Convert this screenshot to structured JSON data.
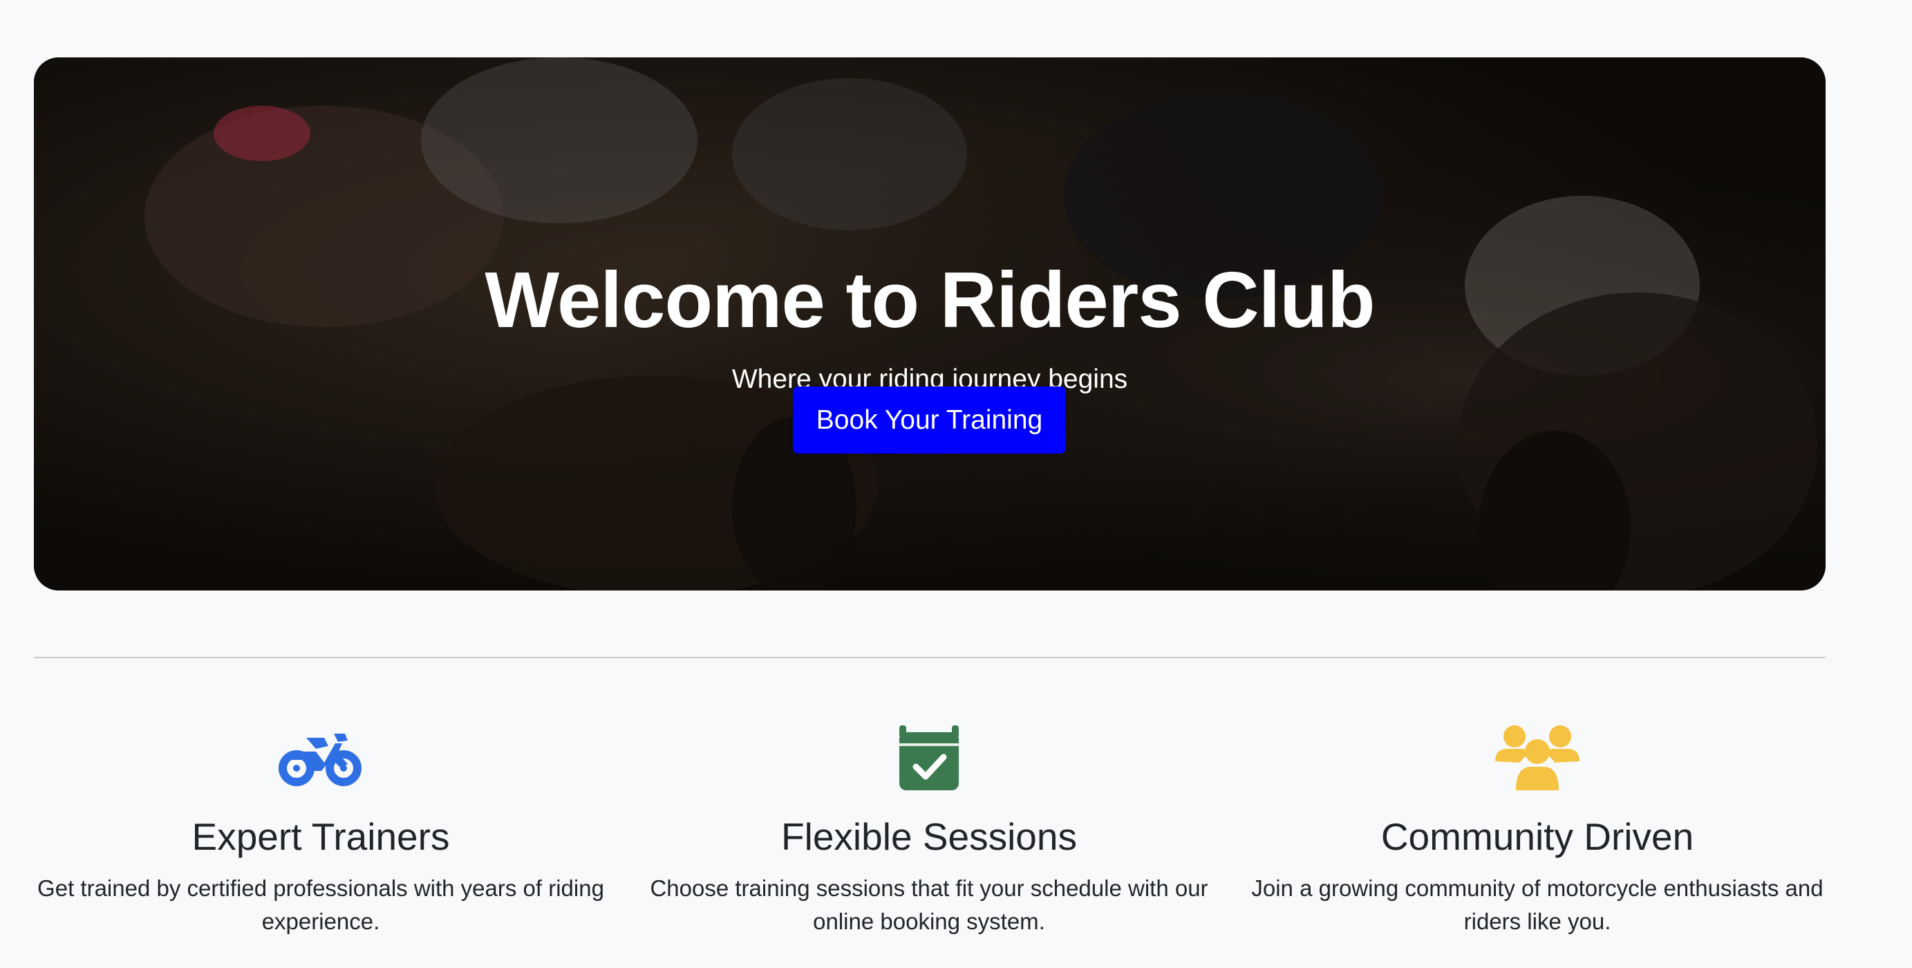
{
  "hero": {
    "title": "Welcome to Riders Club",
    "subtitle": "Where your riding journey begins",
    "cta_label": "Book Your Training",
    "cta_color": "#0000ff",
    "background_image": "motocross-riders-photo"
  },
  "features": [
    {
      "icon": "motorcycle-icon",
      "icon_color": "#2f6fe4",
      "title": "Expert Trainers",
      "text": "Get trained by certified professionals with years of riding experience."
    },
    {
      "icon": "calendar-check-icon",
      "icon_color": "#3b7a4e",
      "title": "Flexible Sessions",
      "text": "Choose training sessions that fit your schedule with our online booking system."
    },
    {
      "icon": "users-icon",
      "icon_color": "#f5c242",
      "title": "Community Driven",
      "text": "Join a growing community of motorcycle enthusiasts and riders like you."
    }
  ]
}
